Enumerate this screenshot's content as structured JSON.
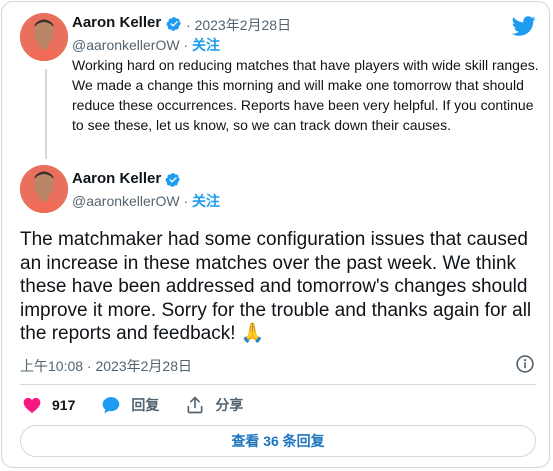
{
  "tweet1": {
    "author_name": "Aaron Keller",
    "handle": "@aaronkellerOW",
    "separator": "·",
    "date": "2023年2月28日",
    "follow_label": "关注",
    "text": "Working hard on reducing matches that have players with wide skill ranges. We made a change this morning and will make one tomorrow that should reduce these occurrences. Reports have been very helpful. If you continue to see these, let us know, so we can track down their causes."
  },
  "tweet2": {
    "author_name": "Aaron Keller",
    "handle": "@aaronkellerOW",
    "separator": "·",
    "follow_label": "关注",
    "text": "The matchmaker had some configuration issues that caused an increase in these matches over the past week. We think these have been addressed and tomorrow's changes should improve it more. Sorry for the trouble and thanks again for all the reports and feedback!",
    "emoji": "🙏",
    "timestamp": "上午10:08 · 2023年2月28日"
  },
  "actions": {
    "like_count": "917",
    "reply_label": "回复",
    "share_label": "分享"
  },
  "replies_button": {
    "prefix": "查看 ",
    "count": "36",
    "suffix": " 条回复"
  },
  "icons": {
    "brand": "twitter-bird-icon",
    "verified": "verified-badge-icon",
    "like": "heart-icon",
    "reply": "speech-bubble-icon",
    "share": "share-upload-icon",
    "info": "info-icon"
  },
  "colors": {
    "brand_blue": "#1d9bf0",
    "like_pink": "#f91880",
    "text": "#0f1419",
    "secondary": "#536471",
    "border": "#cfd9de"
  }
}
